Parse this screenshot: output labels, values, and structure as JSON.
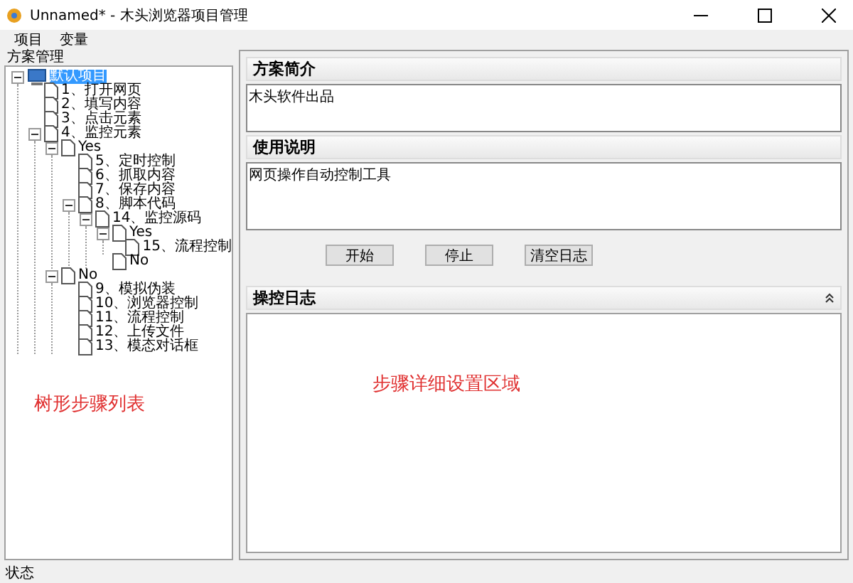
{
  "window": {
    "title": "Unnamed* - 木头浏览器项目管理"
  },
  "menu": [
    "项目",
    "变量"
  ],
  "tree_panel": {
    "title": "方案管理",
    "annotation": "树形步骤列表",
    "root": {
      "label": "默认项目",
      "selected": true,
      "expanded": true,
      "children": [
        {
          "label": "1、打开网页",
          "selected": false
        },
        {
          "label": "2、填写内容",
          "selected": false
        },
        {
          "label": "3、点击元素",
          "selected": false
        },
        {
          "label": "4、监控元素",
          "selected": false,
          "expanded": true,
          "children": [
            {
              "label": "Yes",
              "selected": false,
              "expanded": true,
              "children": [
                {
                  "label": "5、定时控制",
                  "selected": false
                },
                {
                  "label": "6、抓取内容",
                  "selected": false
                },
                {
                  "label": "7、保存内容",
                  "selected": false
                },
                {
                  "label": "8、脚本代码",
                  "selected": false,
                  "expanded": true,
                  "children": [
                    {
                      "label": "14、监控源码",
                      "selected": false,
                      "expanded": true,
                      "children": [
                        {
                          "label": "Yes",
                          "selected": false,
                          "expanded": true,
                          "children": [
                            {
                              "label": "15、流程控制",
                              "selected": false
                            }
                          ]
                        },
                        {
                          "label": "No",
                          "selected": false
                        }
                      ]
                    }
                  ]
                }
              ]
            },
            {
              "label": "No",
              "selected": false,
              "expanded": true,
              "children": [
                {
                  "label": "9、模拟伪装",
                  "selected": false
                },
                {
                  "label": "10、浏览器控制",
                  "selected": false
                },
                {
                  "label": "11、流程控制",
                  "selected": false
                },
                {
                  "label": "12、上传文件",
                  "selected": false
                },
                {
                  "label": "13、模态对话框",
                  "selected": false
                }
              ]
            }
          ]
        }
      ]
    }
  },
  "detail_panel": {
    "annotation": "步骤详细设置区域",
    "intro": {
      "title": "方案简介",
      "value": "木头软件出品"
    },
    "usage": {
      "title": "使用说明",
      "value": "网页操作自动控制工具"
    },
    "buttons": [
      "开始",
      "停止",
      "清空日志"
    ],
    "log": {
      "title": "操控日志"
    }
  },
  "status_bar": "状态"
}
